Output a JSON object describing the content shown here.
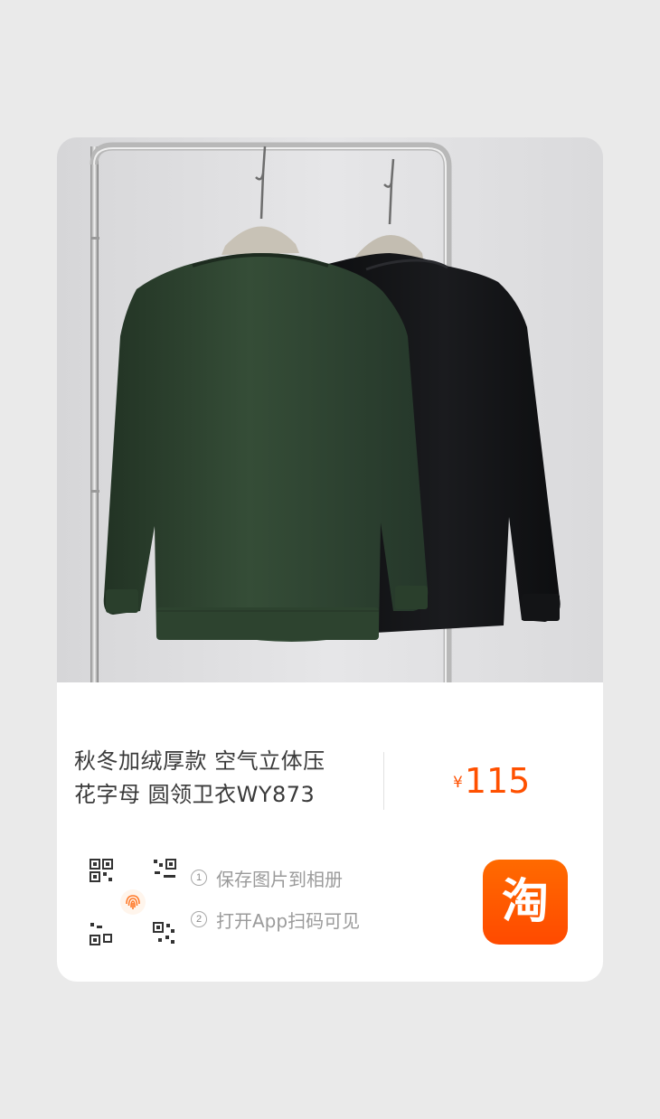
{
  "product": {
    "image_alt": "green and black crewneck sweatshirts on clothing rack",
    "title_line1": "秋冬加绒厚款 空气立体压",
    "title_line2": "花字母 圆领卫衣WY873",
    "price_currency": "¥",
    "price_amount": "115"
  },
  "instructions": {
    "step1_num": "1",
    "step1_text": "保存图片到相册",
    "step2_num": "2",
    "step2_text": "打开App扫码可见"
  },
  "brand": {
    "logo_char": "淘",
    "accent_color": "#ff5000"
  },
  "icons": {
    "qr": "qr-code-icon",
    "fingerprint": "fingerprint-icon",
    "taobao": "taobao-logo-icon"
  }
}
